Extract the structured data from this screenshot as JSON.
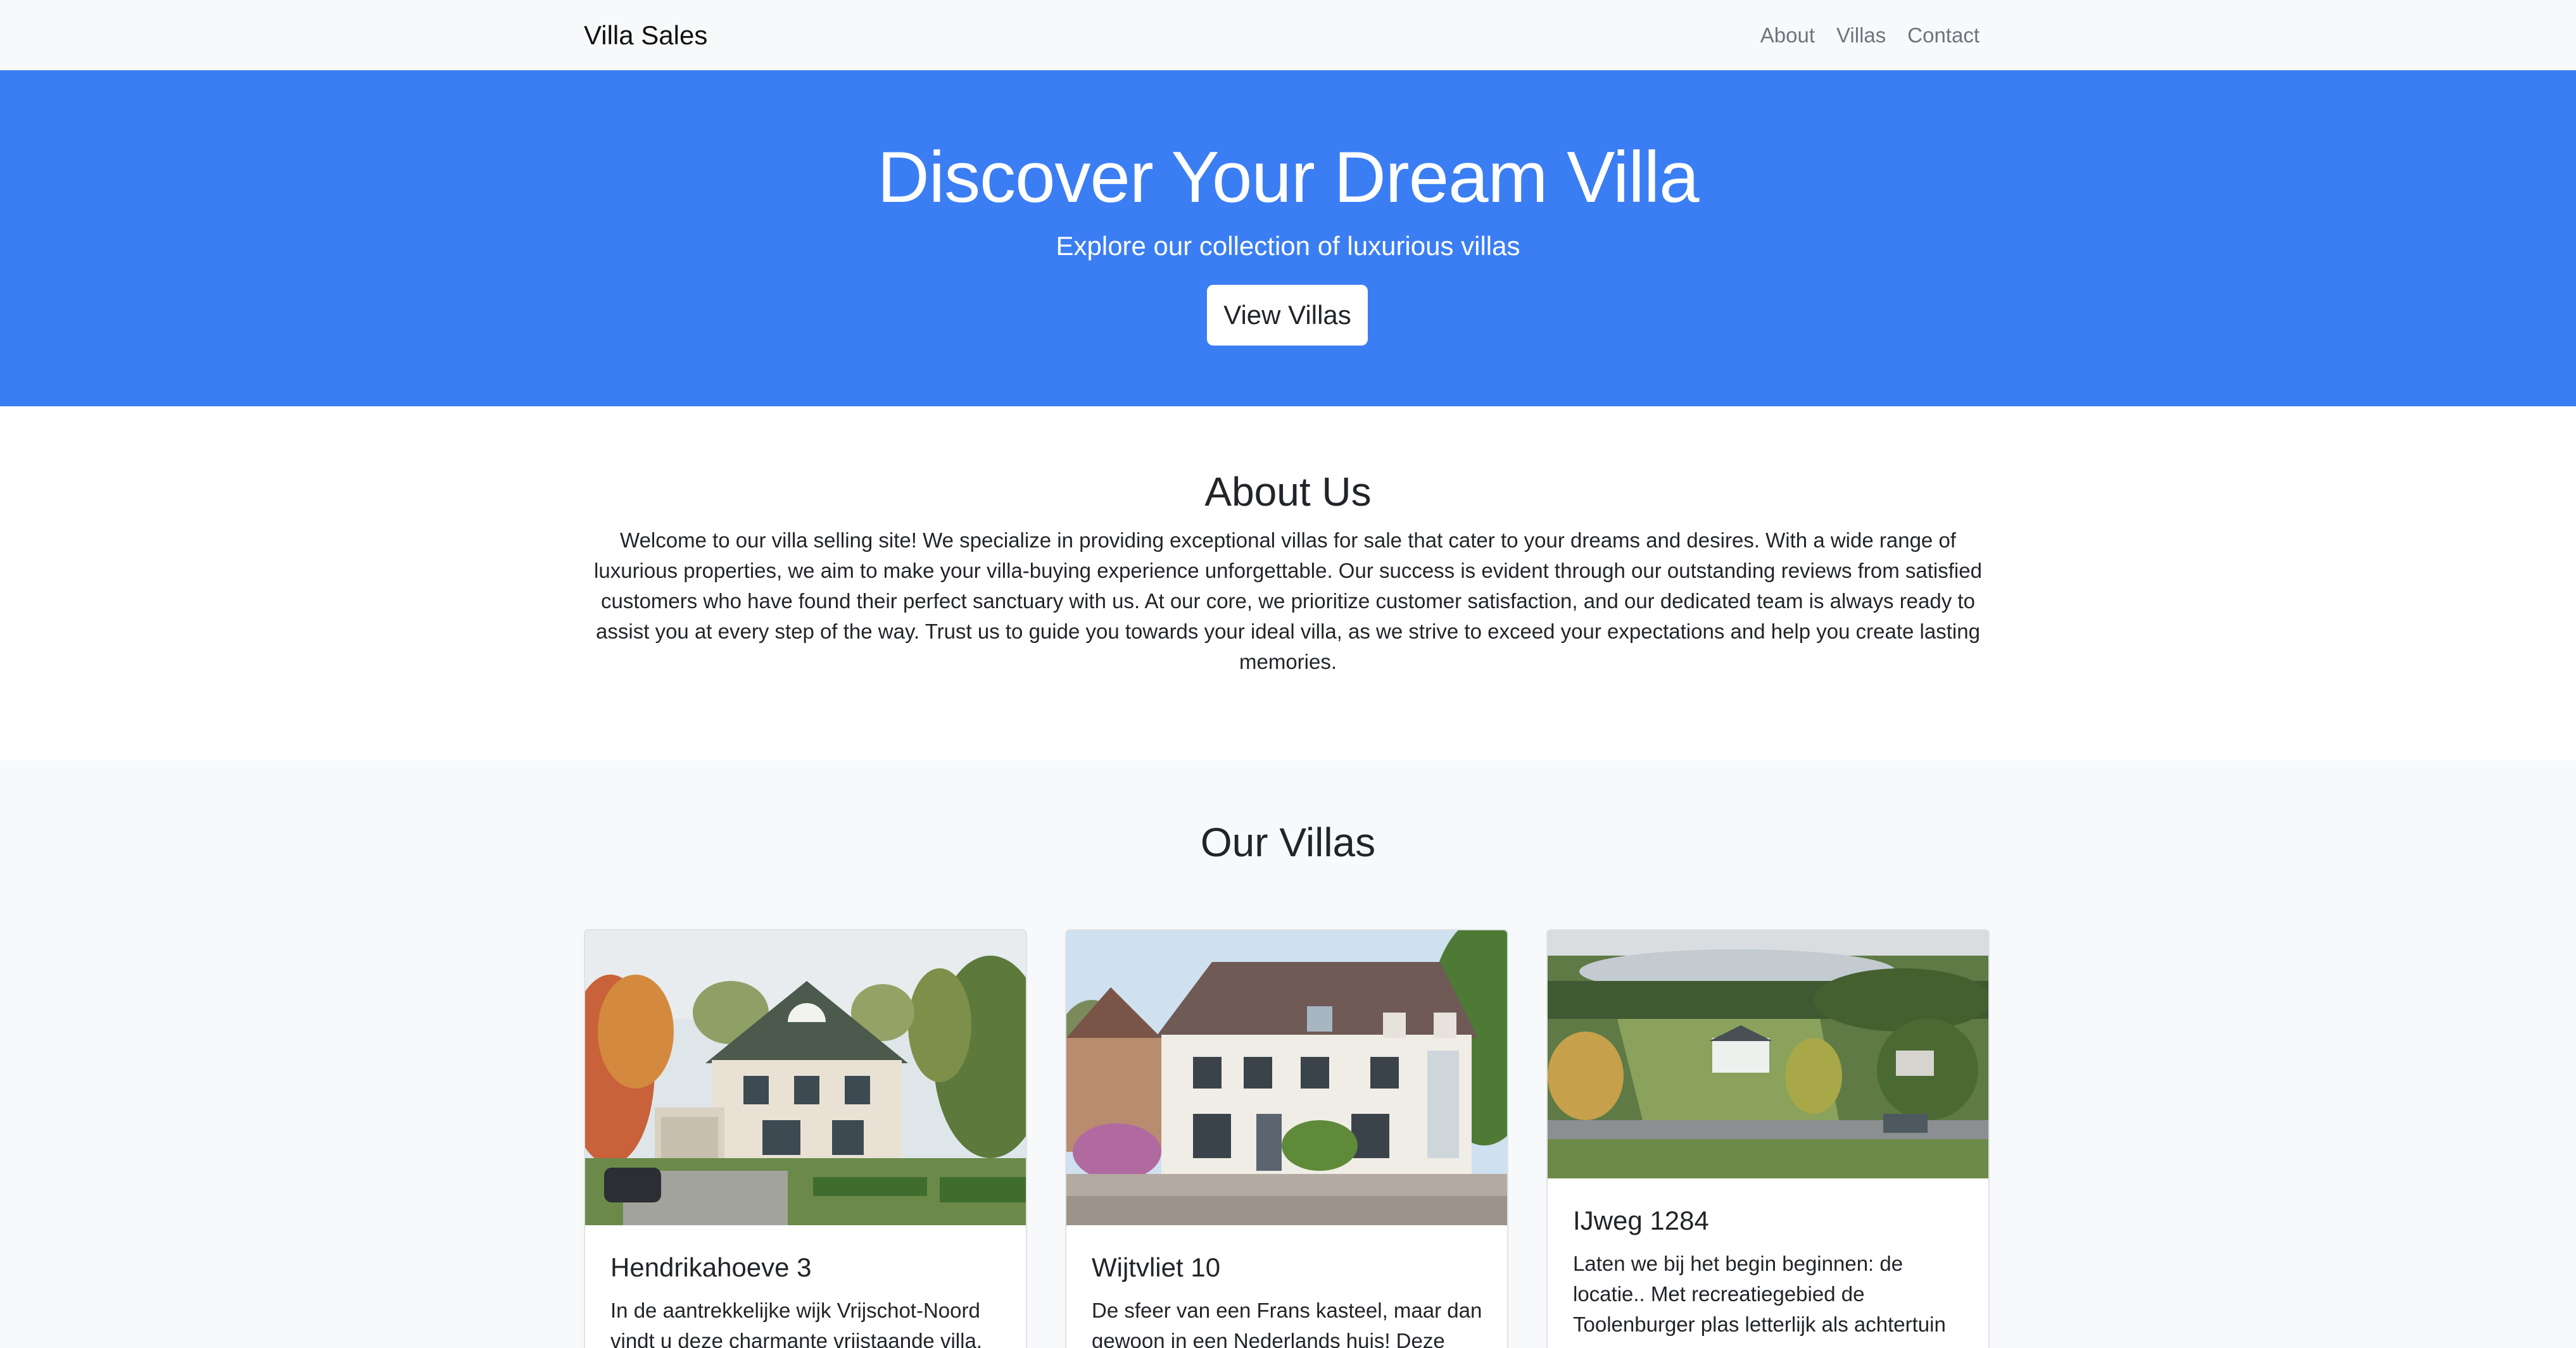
{
  "navbar": {
    "brand": "Villa Sales",
    "links": [
      "About",
      "Villas",
      "Contact"
    ]
  },
  "hero": {
    "title": "Discover Your Dream Villa",
    "subtitle": "Explore our collection of luxurious villas",
    "button": "View Villas"
  },
  "about": {
    "title": "About Us",
    "text": "Welcome to our villa selling site! We specialize in providing exceptional villas for sale that cater to your dreams and desires. With a wide range of luxurious properties, we aim to make your villa-buying experience unforgettable. Our success is evident through our outstanding reviews from satisfied customers who have found their perfect sanctuary with us. At our core, we prioritize customer satisfaction, and our dedicated team is always ready to assist you at every step of the way. Trust us to guide you towards your ideal villa, as we strive to exceed your expectations and help you create lasting memories."
  },
  "villas": {
    "title": "Our Villas",
    "items": [
      {
        "name": "Hendrikahoeve 3",
        "text": "In de aantrekkelijke wijk Vrijschot-Noord vindt u deze charmante vrijstaande villa."
      },
      {
        "name": "Wijtvliet 10",
        "text": "De sfeer van een Frans kasteel, maar dan gewoon in een Nederlands huis! Deze"
      },
      {
        "name": "IJweg 1284",
        "text": "Laten we bij het begin beginnen: de locatie.. Met recreatiegebied de Toolenburger plas letterlijk als achtertuin"
      }
    ]
  },
  "colors": {
    "hero_bg": "#3b7ef4",
    "navbar_bg": "#f8f9fa",
    "section_bg": "#f8f9fa"
  }
}
